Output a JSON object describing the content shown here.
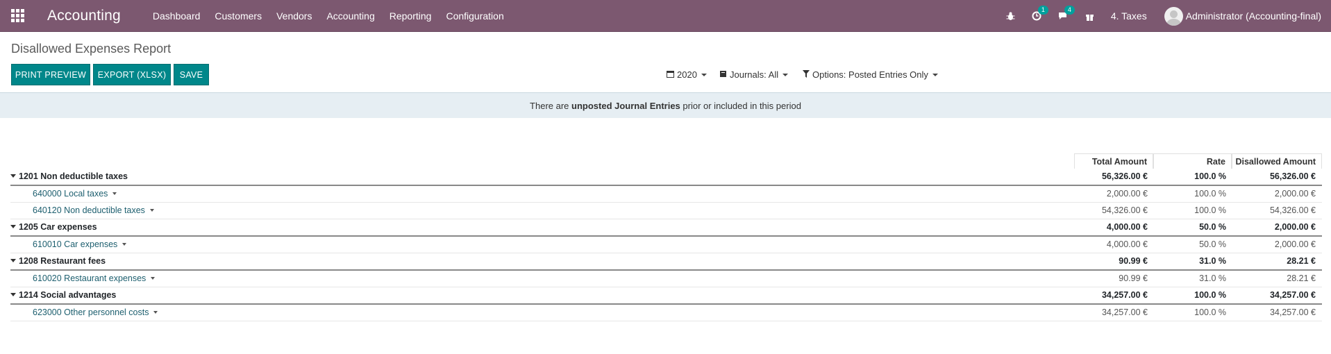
{
  "navbar": {
    "brand": "Accounting",
    "menu": [
      "Dashboard",
      "Customers",
      "Vendors",
      "Accounting",
      "Reporting",
      "Configuration"
    ],
    "activity_badge": "1",
    "messages_badge": "4",
    "company": "4. Taxes",
    "user": "Administrator (Accounting-final)"
  },
  "page": {
    "title": "Disallowed Expenses Report",
    "buttons": {
      "print": "PRINT PREVIEW",
      "export": "EXPORT (XLSX)",
      "save": "SAVE"
    },
    "filters": {
      "date": "2020",
      "journals": "Journals: All",
      "options": "Options: Posted Entries Only"
    }
  },
  "alert": {
    "prefix": "There are ",
    "strong": "unposted Journal Entries",
    "suffix": " prior or included in this period"
  },
  "table": {
    "columns": [
      "Total Amount",
      "Rate",
      "Disallowed Amount"
    ],
    "rows": [
      {
        "kind": "group",
        "label": "1201 Non deductible taxes",
        "total": "56,326.00 €",
        "rate": "100.0 %",
        "disallowed": "56,326.00 €"
      },
      {
        "kind": "line",
        "label": "640000 Local taxes",
        "total": "2,000.00 €",
        "rate": "100.0 %",
        "disallowed": "2,000.00 €"
      },
      {
        "kind": "line",
        "label": "640120 Non deductible taxes",
        "total": "54,326.00 €",
        "rate": "100.0 %",
        "disallowed": "54,326.00 €"
      },
      {
        "kind": "group",
        "label": "1205 Car expenses",
        "total": "4,000.00 €",
        "rate": "50.0 %",
        "disallowed": "2,000.00 €"
      },
      {
        "kind": "line",
        "label": "610010 Car expenses",
        "total": "4,000.00 €",
        "rate": "50.0 %",
        "disallowed": "2,000.00 €"
      },
      {
        "kind": "group",
        "label": "1208 Restaurant fees",
        "total": "90.99 €",
        "rate": "31.0 %",
        "disallowed": "28.21 €"
      },
      {
        "kind": "line",
        "label": "610020 Restaurant expenses",
        "total": "90.99 €",
        "rate": "31.0 %",
        "disallowed": "28.21 €"
      },
      {
        "kind": "group",
        "label": "1214 Social advantages",
        "total": "34,257.00 €",
        "rate": "100.0 %",
        "disallowed": "34,257.00 €"
      },
      {
        "kind": "line",
        "label": "623000 Other personnel costs",
        "total": "34,257.00 €",
        "rate": "100.0 %",
        "disallowed": "34,257.00 €"
      }
    ]
  },
  "colors": {
    "navbar": "#7c5870",
    "button": "#00878a",
    "alert_bg": "#e6eef3",
    "account_link": "#1c5e6e"
  }
}
